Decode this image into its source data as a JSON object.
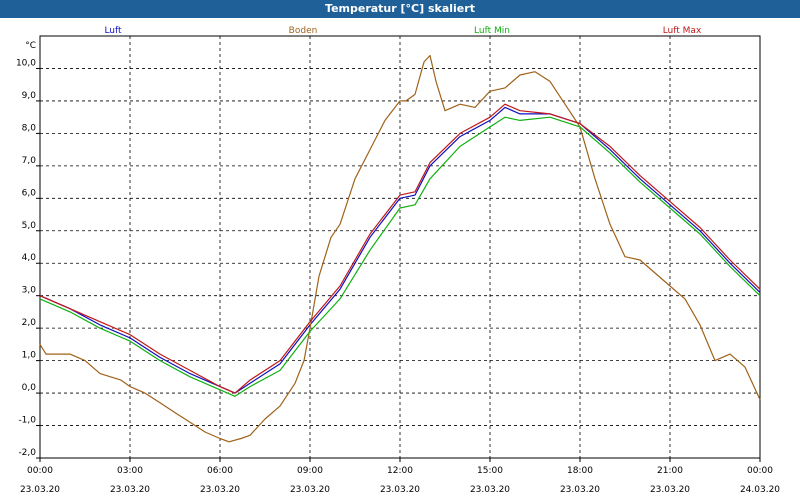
{
  "window": {
    "title": "Temperatur [°C] skaliert"
  },
  "chart_data": {
    "type": "line",
    "title": "Temperatur [°C] skaliert",
    "ylabel": "°C",
    "xlabel": "",
    "ylim": [
      -2.0,
      11.0
    ],
    "xlim": [
      0,
      24
    ],
    "grid": true,
    "legend_position": "top",
    "y_ticks": [
      {
        "value": -2.0,
        "label": "-2,0"
      },
      {
        "value": -1.0,
        "label": "-1,0"
      },
      {
        "value": 0.0,
        "label": "0,0"
      },
      {
        "value": 1.0,
        "label": "1,0"
      },
      {
        "value": 2.0,
        "label": "2,0"
      },
      {
        "value": 3.0,
        "label": "3,0"
      },
      {
        "value": 4.0,
        "label": "4,0"
      },
      {
        "value": 5.0,
        "label": "5,0"
      },
      {
        "value": 6.0,
        "label": "6,0"
      },
      {
        "value": 7.0,
        "label": "7,0"
      },
      {
        "value": 8.0,
        "label": "8,0"
      },
      {
        "value": 9.0,
        "label": "9,0"
      },
      {
        "value": 10.0,
        "label": "10,0"
      }
    ],
    "x_ticks": [
      {
        "value": 0,
        "time": "00:00",
        "date": "23.03.20"
      },
      {
        "value": 3,
        "time": "03:00",
        "date": "23.03.20"
      },
      {
        "value": 6,
        "time": "06:00",
        "date": "23.03.20"
      },
      {
        "value": 9,
        "time": "09:00",
        "date": "23.03.20"
      },
      {
        "value": 12,
        "time": "12:00",
        "date": "23.03.20"
      },
      {
        "value": 15,
        "time": "15:00",
        "date": "23.03.20"
      },
      {
        "value": 18,
        "time": "18:00",
        "date": "23.03.20"
      },
      {
        "value": 21,
        "time": "21:00",
        "date": "23.03.20"
      },
      {
        "value": 24,
        "time": "00:00",
        "date": "24.03.20"
      }
    ],
    "series": [
      {
        "name": "Luft",
        "color": "#1010c0",
        "x": [
          0,
          1,
          2,
          3,
          4,
          5,
          6,
          6.5,
          7,
          8,
          9,
          10,
          11,
          12,
          12.5,
          13,
          14,
          15,
          15.5,
          16,
          17,
          18,
          19,
          20,
          21,
          22,
          23,
          24
        ],
        "y": [
          3.0,
          2.6,
          2.1,
          1.7,
          1.1,
          0.6,
          0.2,
          0.0,
          0.3,
          0.9,
          2.1,
          3.2,
          4.8,
          6.0,
          6.1,
          7.0,
          7.9,
          8.4,
          8.8,
          8.6,
          8.6,
          8.3,
          7.5,
          6.6,
          5.8,
          5.0,
          4.0,
          3.1
        ]
      },
      {
        "name": "Boden",
        "color": "#a0621a",
        "x": [
          0,
          0.2,
          1,
          1.5,
          2,
          2.7,
          3,
          3.5,
          4,
          4.5,
          5,
          5.5,
          6,
          6.3,
          6.7,
          7,
          7.5,
          8,
          8.5,
          8.8,
          9,
          9.3,
          9.7,
          10,
          10.5,
          11,
          11.5,
          12,
          12.2,
          12.5,
          12.8,
          13,
          13.2,
          13.5,
          14,
          14.5,
          15,
          15.5,
          16,
          16.5,
          17,
          17.5,
          18,
          18.5,
          19,
          19.5,
          20,
          20.5,
          21,
          21.5,
          22,
          22.5,
          23,
          23.5,
          24
        ],
        "y": [
          1.5,
          1.2,
          1.2,
          1.0,
          0.6,
          0.4,
          0.2,
          0.0,
          -0.3,
          -0.6,
          -0.9,
          -1.2,
          -1.4,
          -1.5,
          -1.4,
          -1.3,
          -0.8,
          -0.4,
          0.3,
          1.0,
          2.0,
          3.6,
          4.8,
          5.2,
          6.6,
          7.5,
          8.4,
          9.0,
          9.0,
          9.2,
          10.2,
          10.4,
          9.6,
          8.7,
          8.9,
          8.8,
          9.3,
          9.4,
          9.8,
          9.9,
          9.6,
          8.9,
          8.2,
          6.6,
          5.2,
          4.2,
          4.1,
          3.7,
          3.3,
          2.9,
          2.1,
          1.0,
          1.2,
          0.8,
          -0.2
        ]
      },
      {
        "name": "Luft Min",
        "color": "#10b010",
        "x": [
          0,
          1,
          2,
          3,
          4,
          5,
          6,
          6.5,
          7,
          8,
          9,
          10,
          11,
          12,
          12.5,
          13,
          14,
          15,
          15.5,
          16,
          17,
          18,
          19,
          20,
          21,
          22,
          23,
          24
        ],
        "y": [
          2.9,
          2.5,
          2.0,
          1.6,
          1.0,
          0.5,
          0.1,
          -0.1,
          0.2,
          0.7,
          1.9,
          2.9,
          4.4,
          5.7,
          5.8,
          6.6,
          7.6,
          8.2,
          8.5,
          8.4,
          8.5,
          8.2,
          7.4,
          6.5,
          5.7,
          4.9,
          3.9,
          3.0
        ]
      },
      {
        "name": "Luft Max",
        "color": "#c01818",
        "x": [
          0,
          1,
          2,
          3,
          4,
          5,
          6,
          6.5,
          7,
          8,
          9,
          10,
          11,
          12,
          12.5,
          13,
          14,
          15,
          15.5,
          16,
          17,
          18,
          19,
          20,
          21,
          22,
          23,
          24
        ],
        "y": [
          3.0,
          2.6,
          2.2,
          1.8,
          1.2,
          0.7,
          0.2,
          0.0,
          0.4,
          1.0,
          2.2,
          3.3,
          4.9,
          6.1,
          6.2,
          7.1,
          8.0,
          8.5,
          8.9,
          8.7,
          8.6,
          8.3,
          7.6,
          6.7,
          5.9,
          5.1,
          4.1,
          3.2
        ]
      }
    ]
  }
}
